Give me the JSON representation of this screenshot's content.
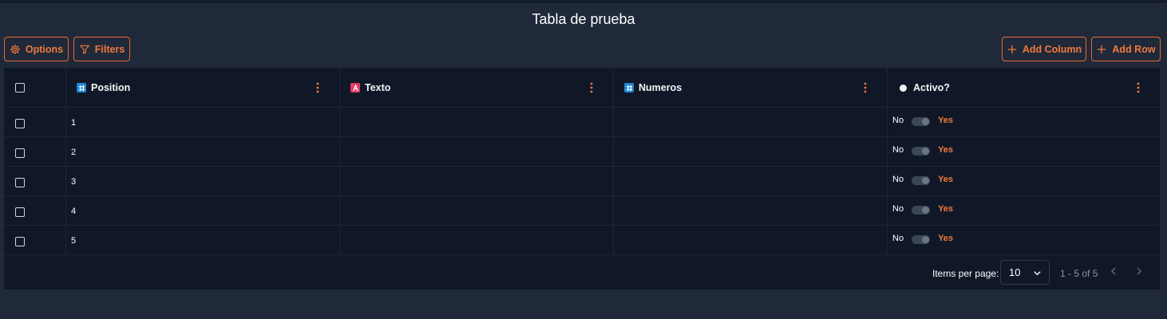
{
  "page": {
    "title": "Tabla de prueba"
  },
  "toolbar": {
    "options_label": "Options",
    "filters_label": "Filters",
    "add_column_label": "Add Column",
    "add_row_label": "Add Row"
  },
  "columns": [
    {
      "label": "Position",
      "type": "number"
    },
    {
      "label": "Texto",
      "type": "text"
    },
    {
      "label": "Numeros",
      "type": "number"
    },
    {
      "label": "Activo?",
      "type": "boolean"
    }
  ],
  "rows": [
    {
      "position": "1",
      "texto": "",
      "numeros": "",
      "activo_no": "No",
      "activo_yes": "Yes"
    },
    {
      "position": "2",
      "texto": "",
      "numeros": "",
      "activo_no": "No",
      "activo_yes": "Yes"
    },
    {
      "position": "3",
      "texto": "",
      "numeros": "",
      "activo_no": "No",
      "activo_yes": "Yes"
    },
    {
      "position": "4",
      "texto": "",
      "numeros": "",
      "activo_no": "No",
      "activo_yes": "Yes"
    },
    {
      "position": "5",
      "texto": "",
      "numeros": "",
      "activo_no": "No",
      "activo_yes": "Yes"
    }
  ],
  "paginator": {
    "items_per_page_label": "Items per page:",
    "items_per_page_value": "10",
    "range_label": "1 - 5 of 5"
  },
  "colors": {
    "accent": "#f07a3a",
    "background": "#1f293a",
    "table_background": "#101828",
    "number_type": "#1e88d6",
    "text_type": "#e53962"
  },
  "icons": {
    "options": "gear-icon",
    "filters": "filter-icon",
    "add": "plus-icon",
    "column_menu": "kebab-icon",
    "select_chevron": "chevron-down-icon",
    "prev": "chevron-left-icon",
    "next": "chevron-right-icon"
  }
}
